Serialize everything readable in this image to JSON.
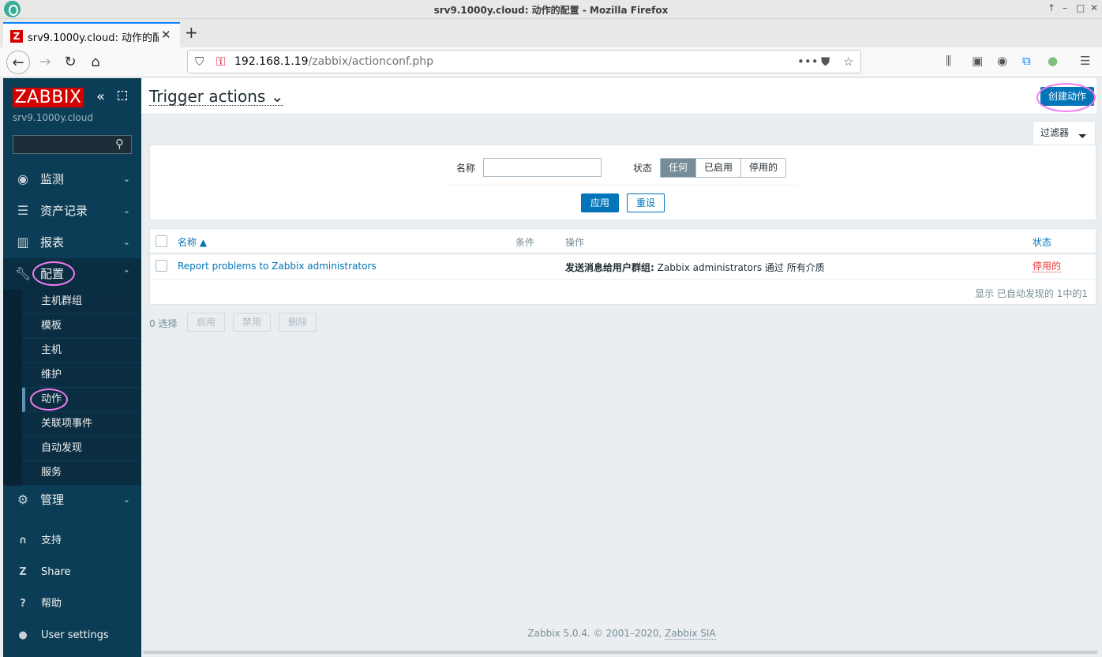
{
  "window": {
    "title": "srv9.1000y.cloud: 动作的配置 - Mozilla Firefox",
    "controls": [
      "↑",
      "–",
      "□",
      "✕"
    ]
  },
  "browser": {
    "tab_title": "srv9.1000y.cloud: 动作的配置",
    "tab_favicon": "Z",
    "url_host": "192.168.1.19",
    "url_path": "/zabbix/actionconf.php"
  },
  "sidebar": {
    "logo": "ZABBIX",
    "server_name": "srv9.1000y.cloud",
    "search_placeholder": "",
    "menu": [
      {
        "label": "监测",
        "icon": "eye-icon",
        "chevron": "⌄"
      },
      {
        "label": "资产记录",
        "icon": "list-icon",
        "chevron": "⌄"
      },
      {
        "label": "报表",
        "icon": "bar-chart-icon",
        "chevron": "⌄"
      },
      {
        "label": "配置",
        "icon": "wrench-icon",
        "chevron": "⌃"
      },
      {
        "label": "管理",
        "icon": "gear-icon",
        "chevron": "⌄"
      }
    ],
    "submenu": [
      "主机群组",
      "模板",
      "主机",
      "维护",
      "动作",
      "关联项事件",
      "自动发现",
      "服务"
    ],
    "active_submenu": "动作",
    "bottom": [
      {
        "label": "支持",
        "icon": "headset-icon"
      },
      {
        "label": "Share",
        "icon": "zabbix-share-icon"
      },
      {
        "label": "帮助",
        "icon": "help-icon"
      },
      {
        "label": "User settings",
        "icon": "user-icon"
      }
    ]
  },
  "header": {
    "title": "Trigger actions",
    "create_button": "创建动作"
  },
  "filter": {
    "tab_label": "过滤器",
    "name_label": "名称",
    "name_value": "",
    "status_label": "状态",
    "status_options": [
      "任何",
      "已启用",
      "停用的"
    ],
    "status_selected": "任何",
    "apply": "应用",
    "reset": "重设"
  },
  "table": {
    "columns": {
      "name": "名称 ▲",
      "conditions": "条件",
      "operations": "操作",
      "status": "状态"
    },
    "rows": [
      {
        "name": "Report problems to Zabbix administrators",
        "conditions": "",
        "operation_bold": "发送消息给用户群组:",
        "operation_rest": " Zabbix administrators 通过 所有介质",
        "status": "停用的"
      }
    ],
    "footer": "显示 已自动发现的 1中的1"
  },
  "mass_actions": {
    "selected": "0 选择",
    "enable": "启用",
    "disable": "禁用",
    "delete": "删除"
  },
  "footer": {
    "text": "Zabbix 5.0.4. © 2001–2020, ",
    "link": "Zabbix SIA"
  },
  "colors": {
    "accent": "#0275b8",
    "sidebar": "#0b3d56",
    "logo": "#d40000",
    "disabled_status": "#e33734",
    "annotation": "#f27cf0"
  }
}
